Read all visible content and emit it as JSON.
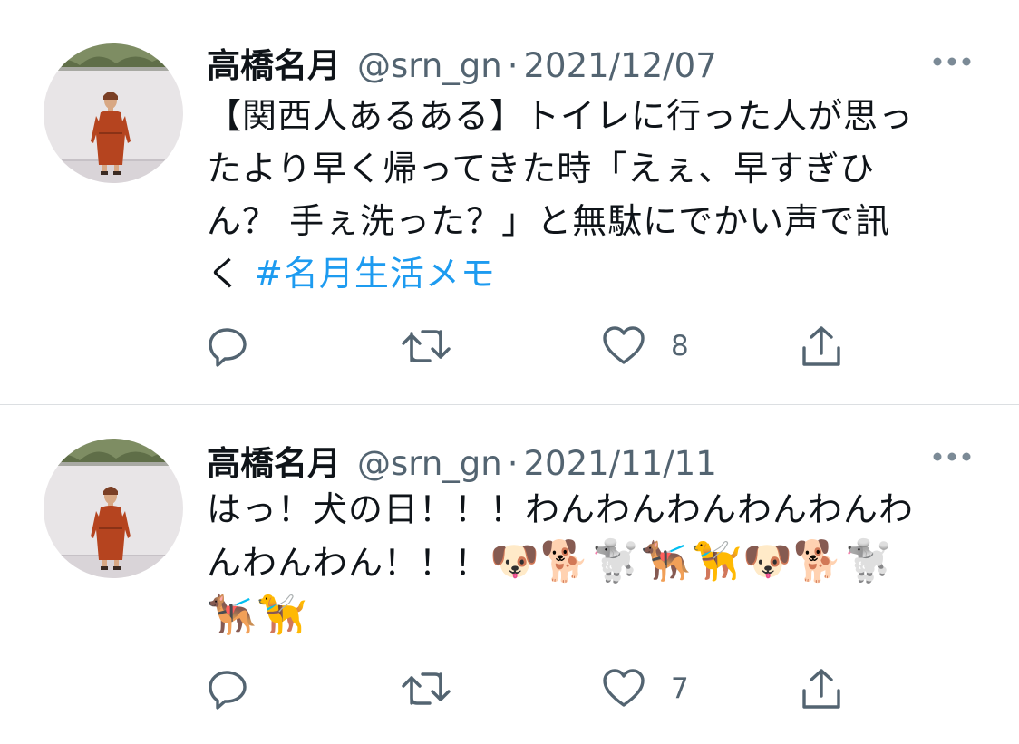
{
  "tweets": [
    {
      "name": "高橋名月",
      "handle": "@srn_gn",
      "separator": "·",
      "date": "2021/12/07",
      "text_lines": [
        "【関西人あるある】トイレに行った人が思っ",
        "たより早く帰ってきた時「えぇ、早すぎひ",
        "ん？ 手ぇ洗った？」と無駄にでかい声で訊",
        "く "
      ],
      "hashtag": "#名月生活メモ",
      "like_count": "8"
    },
    {
      "name": "高橋名月",
      "handle": "@srn_gn",
      "separator": "·",
      "date": "2021/11/11",
      "text_lines": [
        "はっ！犬の日！！！わんわんわんわんわんわ",
        "んわんわん！！！"
      ],
      "emoji_line_2": "🐶🐕🐩🐕‍🦺🦮🐶🐕🐩",
      "emoji_line_3": "🐕‍🦺🦮",
      "like_count": "7"
    }
  ],
  "icons": {
    "reply": "reply-icon",
    "retweet": "retweet-icon",
    "like": "heart-icon",
    "share": "share-icon",
    "more": "more-icon"
  },
  "colors": {
    "text": "#0f1419",
    "secondary": "#536471",
    "hashtag": "#1d9bf0",
    "divider": "#dcdfe2"
  }
}
